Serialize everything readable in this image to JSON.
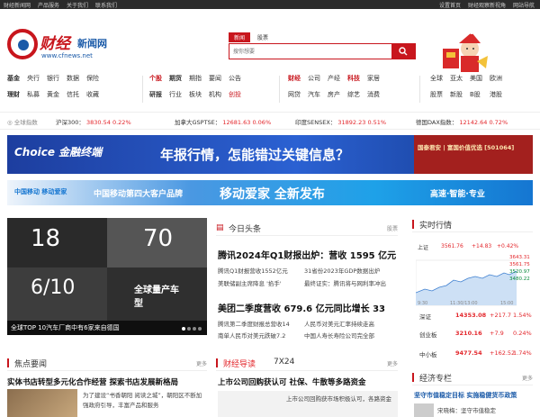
{
  "topbar": {
    "left": [
      "财经新闻网",
      "产品服务",
      "关于我们",
      "联系我们"
    ],
    "right": [
      "设置首页",
      "财经观察新视角",
      "网站导航"
    ]
  },
  "logo": {
    "cn": "财经",
    "sub": "新闻网",
    "url": "www.cfnews.net"
  },
  "search": {
    "tabs": [
      "新闻",
      "股票"
    ],
    "placeholder": "搜你想要"
  },
  "nav": {
    "g1": [
      "基金",
      "央行",
      "银行",
      "数据",
      "保险",
      "理财",
      "私募",
      "黄金",
      "信托",
      "收藏"
    ],
    "g2": [
      "个股",
      "期货",
      "期指",
      "要闻",
      "公告",
      "研报",
      "行业",
      "板块",
      "机构",
      "创投"
    ],
    "g3": [
      "财经",
      "公司",
      "产经",
      "科技",
      "家居",
      "网贷",
      "汽车",
      "房产",
      "综艺",
      "消费"
    ],
    "g4": [
      "全球",
      "亚太",
      "美国",
      "欧洲",
      "股票",
      "新股",
      "B股",
      "港股"
    ]
  },
  "ticker": {
    "label": "全球指数",
    "items": [
      {
        "name": "沪深300：",
        "value": "3830.54",
        "change": "0.22%"
      },
      {
        "name": "加拿大GSPTSE：",
        "value": "12681.63",
        "change": "0.06%"
      },
      {
        "name": "印度SENSEX：",
        "value": "31892.23",
        "change": "0.51%"
      },
      {
        "name": "德国DAX指数：",
        "value": "12142.64",
        "change": "0.72%"
      }
    ]
  },
  "banner1": {
    "brand": "Choice 金融终端",
    "tagline": "年报行情，怎能错过关键信息？",
    "side": "国泰君安 | 富国价值优选 [501064]"
  },
  "banner2": {
    "brand": "中国移动 移动爱家",
    "tagline": "中国移动第四大客户品牌",
    "slogan": "移动爱家 全新发布",
    "right": "高速·智能·专业"
  },
  "slides": {
    "caption": "全球TOP 10汽车厂商中有6家来自德国",
    "big1": "18",
    "big2": "70",
    "big3": "6/10",
    "big4": "全球量产车型"
  },
  "sections": {
    "today": {
      "title": "今日头条",
      "more": "股票"
    },
    "market": {
      "title": "实时行情"
    },
    "focus": {
      "title": "焦点要闻",
      "more": "更多"
    },
    "guide": {
      "title": "财经导读",
      "tab": "7X24",
      "more": "更多"
    },
    "column": {
      "title": "经济专栏",
      "more": "更多"
    }
  },
  "headlines": {
    "h1": "腾讯2024年Q1财报出炉：营收 1595 亿元",
    "h1a": "腾讯Q1财报营收1552亿元",
    "h1b": "31省份2023年GDP数据出炉",
    "h1c": "美联储副主席降息 '掐手'",
    "h1d": "最终证实：腾讯将与网利率冲出",
    "h2": "美团二季度营收 679.6 亿元同比增长 33",
    "h2a": "腾讯第二季度财报总营收14",
    "h2b": "人民币对美元汇率持续走高",
    "h2c": "南单人民币对美元跌破7.2",
    "h2d": "中国人寿长寿险公司完全部",
    "focus1": "实体书店转型多元化合作经营 探索书店发展新格局",
    "focus_text": "为了建设“书香朝阳 阅读之城”，朝阳区不断加强政府引导，丰富产品和服务",
    "guide1": "上市公司回购获认可 社保、牛散等多路资金",
    "guide_text": "上市公司回购获市场积极认可，各路资金",
    "col1": "坚守市值稳定目标 实施稳健货币政策",
    "col_text": "宋晓梅：坚守市值稳定"
  },
  "market": {
    "tabs": [
      "上证",
      "3561.76",
      "+14.83",
      "+0.42%"
    ],
    "rows": [
      {
        "name": "深证",
        "value": "14353.08",
        "chg": "+217.7",
        "pct": "1.54%"
      },
      {
        "name": "创业板",
        "value": "3210.16",
        "chg": "+7.9",
        "pct": "0.24%"
      },
      {
        "name": "中小板",
        "value": "9477.54",
        "chg": "+162.52",
        "pct": "1.74%"
      }
    ],
    "axis": [
      "3643.31",
      "3561.75",
      "3520.97",
      "3480.22"
    ],
    "time": [
      "9:30",
      "11:30/13:00",
      "15:00"
    ]
  },
  "colors": {
    "brand": "#c8161d",
    "up": "#e3262b",
    "down": "#0a8a3c"
  }
}
